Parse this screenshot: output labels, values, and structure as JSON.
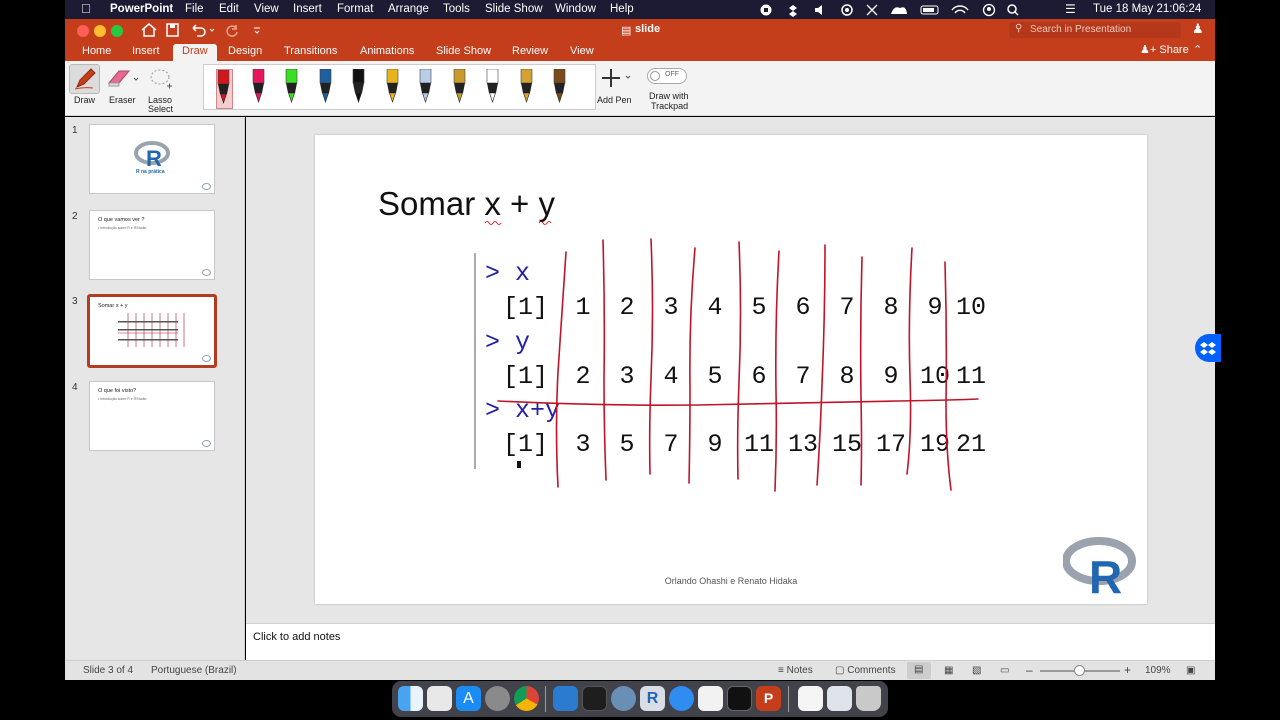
{
  "menubar": {
    "app": "PowerPoint",
    "items": [
      "File",
      "Edit",
      "View",
      "Insert",
      "Format",
      "Arrange",
      "Tools",
      "Slide Show",
      "Window",
      "Help"
    ],
    "datetime": "Tue 18 May  21:06:24"
  },
  "window": {
    "title": "slide",
    "search_placeholder": "Search in Presentation",
    "share_label": "Share"
  },
  "ribbon": {
    "tabs": [
      "Home",
      "Insert",
      "Draw",
      "Design",
      "Transitions",
      "Animations",
      "Slide Show",
      "Review",
      "View"
    ],
    "active_tab": "Draw",
    "tools": {
      "draw": "Draw",
      "eraser": "Eraser",
      "lasso": "Lasso\nSelect",
      "lasso_line1": "Lasso",
      "lasso_line2": "Select",
      "add_pen": "Add Pen",
      "trackpad_line1": "Draw with",
      "trackpad_line2": "Trackpad",
      "toggle_state": "OFF"
    },
    "pen_colors": [
      "#d0171e",
      "#e8175d",
      "#3adf24",
      "#1d5fa0",
      "#111111",
      "#e8b41c",
      "#b9cde8",
      "#c99a2e",
      "#ffffff",
      "#d4a232",
      "#7a4a1a"
    ]
  },
  "thumbnails": [
    {
      "num": "1",
      "title": "R na prática",
      "body": ""
    },
    {
      "num": "2",
      "title": "O que vamos ver ?",
      "body": "• Introdução sobre R e RStudio"
    },
    {
      "num": "3",
      "title": "Somar x + y",
      "body": ""
    },
    {
      "num": "4",
      "title": "O que foi visto?",
      "body": "• Introdução sobre R e RStudio"
    }
  ],
  "active_slide_index": 3,
  "slide": {
    "title": "Somar x + y",
    "prompt_x": "> x",
    "prompt_y": "> y",
    "prompt_sum": "> x+y",
    "index_label": "[1]",
    "x_values": [
      "1",
      "2",
      "3",
      "4",
      "5",
      "6",
      "7",
      "8",
      "9",
      "10"
    ],
    "y_values": [
      "2",
      "3",
      "4",
      "5",
      "6",
      "7",
      "8",
      "9",
      "10",
      "11"
    ],
    "sum_values": [
      "3",
      "5",
      "7",
      "9",
      "11",
      "13",
      "15",
      "17",
      "19",
      "21"
    ],
    "footer": "Orlando Ohashi e Renato Hidaka",
    "ink_color": "#c0142a"
  },
  "notes": {
    "placeholder": "Click to add notes"
  },
  "status": {
    "slide_counter": "Slide 3 of 4",
    "language": "Portuguese (Brazil)",
    "notes_label": "Notes",
    "comments_label": "Comments",
    "zoom": "109%"
  }
}
